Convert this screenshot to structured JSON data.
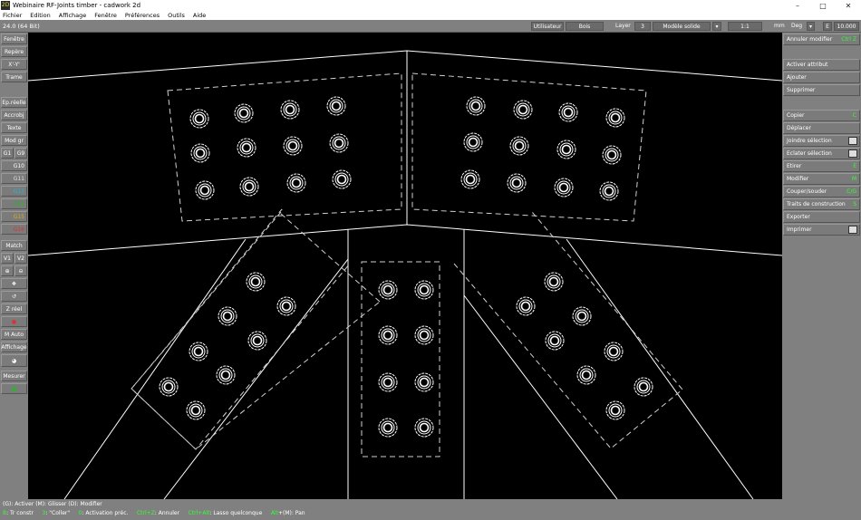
{
  "window": {
    "title": "Webinaire RF-Joints timber - cadwork 2d",
    "app_icon_text": "2D"
  },
  "menu": [
    "Fichier",
    "Edition",
    "Affichage",
    "Fenêtre",
    "Préférences",
    "Outils",
    "Aide"
  ],
  "toolbar": {
    "version": "24.0 (64 Bit)",
    "user": "Utilisateur",
    "material": "Bois",
    "layer_label": "Layer",
    "layer_value": "3",
    "model": "Modèle solide",
    "scale": "1:1",
    "unit": "mm",
    "angle_unit": "Deg",
    "e_label": "E",
    "e_value": "10.000"
  },
  "left_panel": {
    "fenetre": "Fenêtre",
    "repere": "Repère",
    "xy": "X'-Y'",
    "trame": "Trame",
    "ep_reelle": "Ep.réelle",
    "accrobj": "Accrobj",
    "texte": "Texte",
    "mod_gr": "Mod gr",
    "g1": "G1",
    "g9": "G9",
    "g10": "G10",
    "g11": "G11",
    "g13": "G13",
    "g14": "G14",
    "g15": "G15",
    "g16": "G16",
    "match": "Match",
    "v1": "V1",
    "v2": "V2",
    "z_reel": "Z réel",
    "m_auto": "M Auto",
    "affichage": "Affichage",
    "mesurer": "Mesurer"
  },
  "right_panel": {
    "annuler": "Annuler modifier",
    "annuler_sc": "Ctrl Z",
    "activer": "Activer attribut",
    "ajouter": "Ajouter",
    "supprimer": "Supprimer",
    "copier": "Copier",
    "copier_sc": "C",
    "deplacer": "Déplacer",
    "joindre": "Joindre sélection",
    "eclater": "Eclater sélection",
    "etirer": "Etirer",
    "etirer_sc": "E",
    "modifier": "Modifier",
    "modifier_sc": "M",
    "couper": "Couper/souder",
    "couper_sc": "C/G",
    "traits": "Traits de construction",
    "traits_sc": "S",
    "exporter": "Exporter",
    "imprimer": "Imprimer"
  },
  "status": {
    "line1": "(G): Activer    (M): Glisser    (D): Modifier",
    "l2_a_key": "B",
    "l2_a": ": Tr constr",
    "l2_b_key": "3",
    "l2_b": ": \"Coller\"",
    "l2_c_key": "0",
    "l2_c": ": Activation préc.",
    "l2_d_key": "Ctrl+Z",
    "l2_d": ": Annuler",
    "l2_e_key": "Ctrl+Alt",
    "l2_e": ": Lasso quelconque",
    "l2_f_key": "Alt",
    "l2_f": "+(M): Pan"
  },
  "colors": {
    "canvas": "#000000",
    "panel": "#808080",
    "g13": "#19b8d8",
    "g14": "#16c016",
    "g15": "#d8b010",
    "g16": "#e03030",
    "shortcut": "#33ff33"
  }
}
